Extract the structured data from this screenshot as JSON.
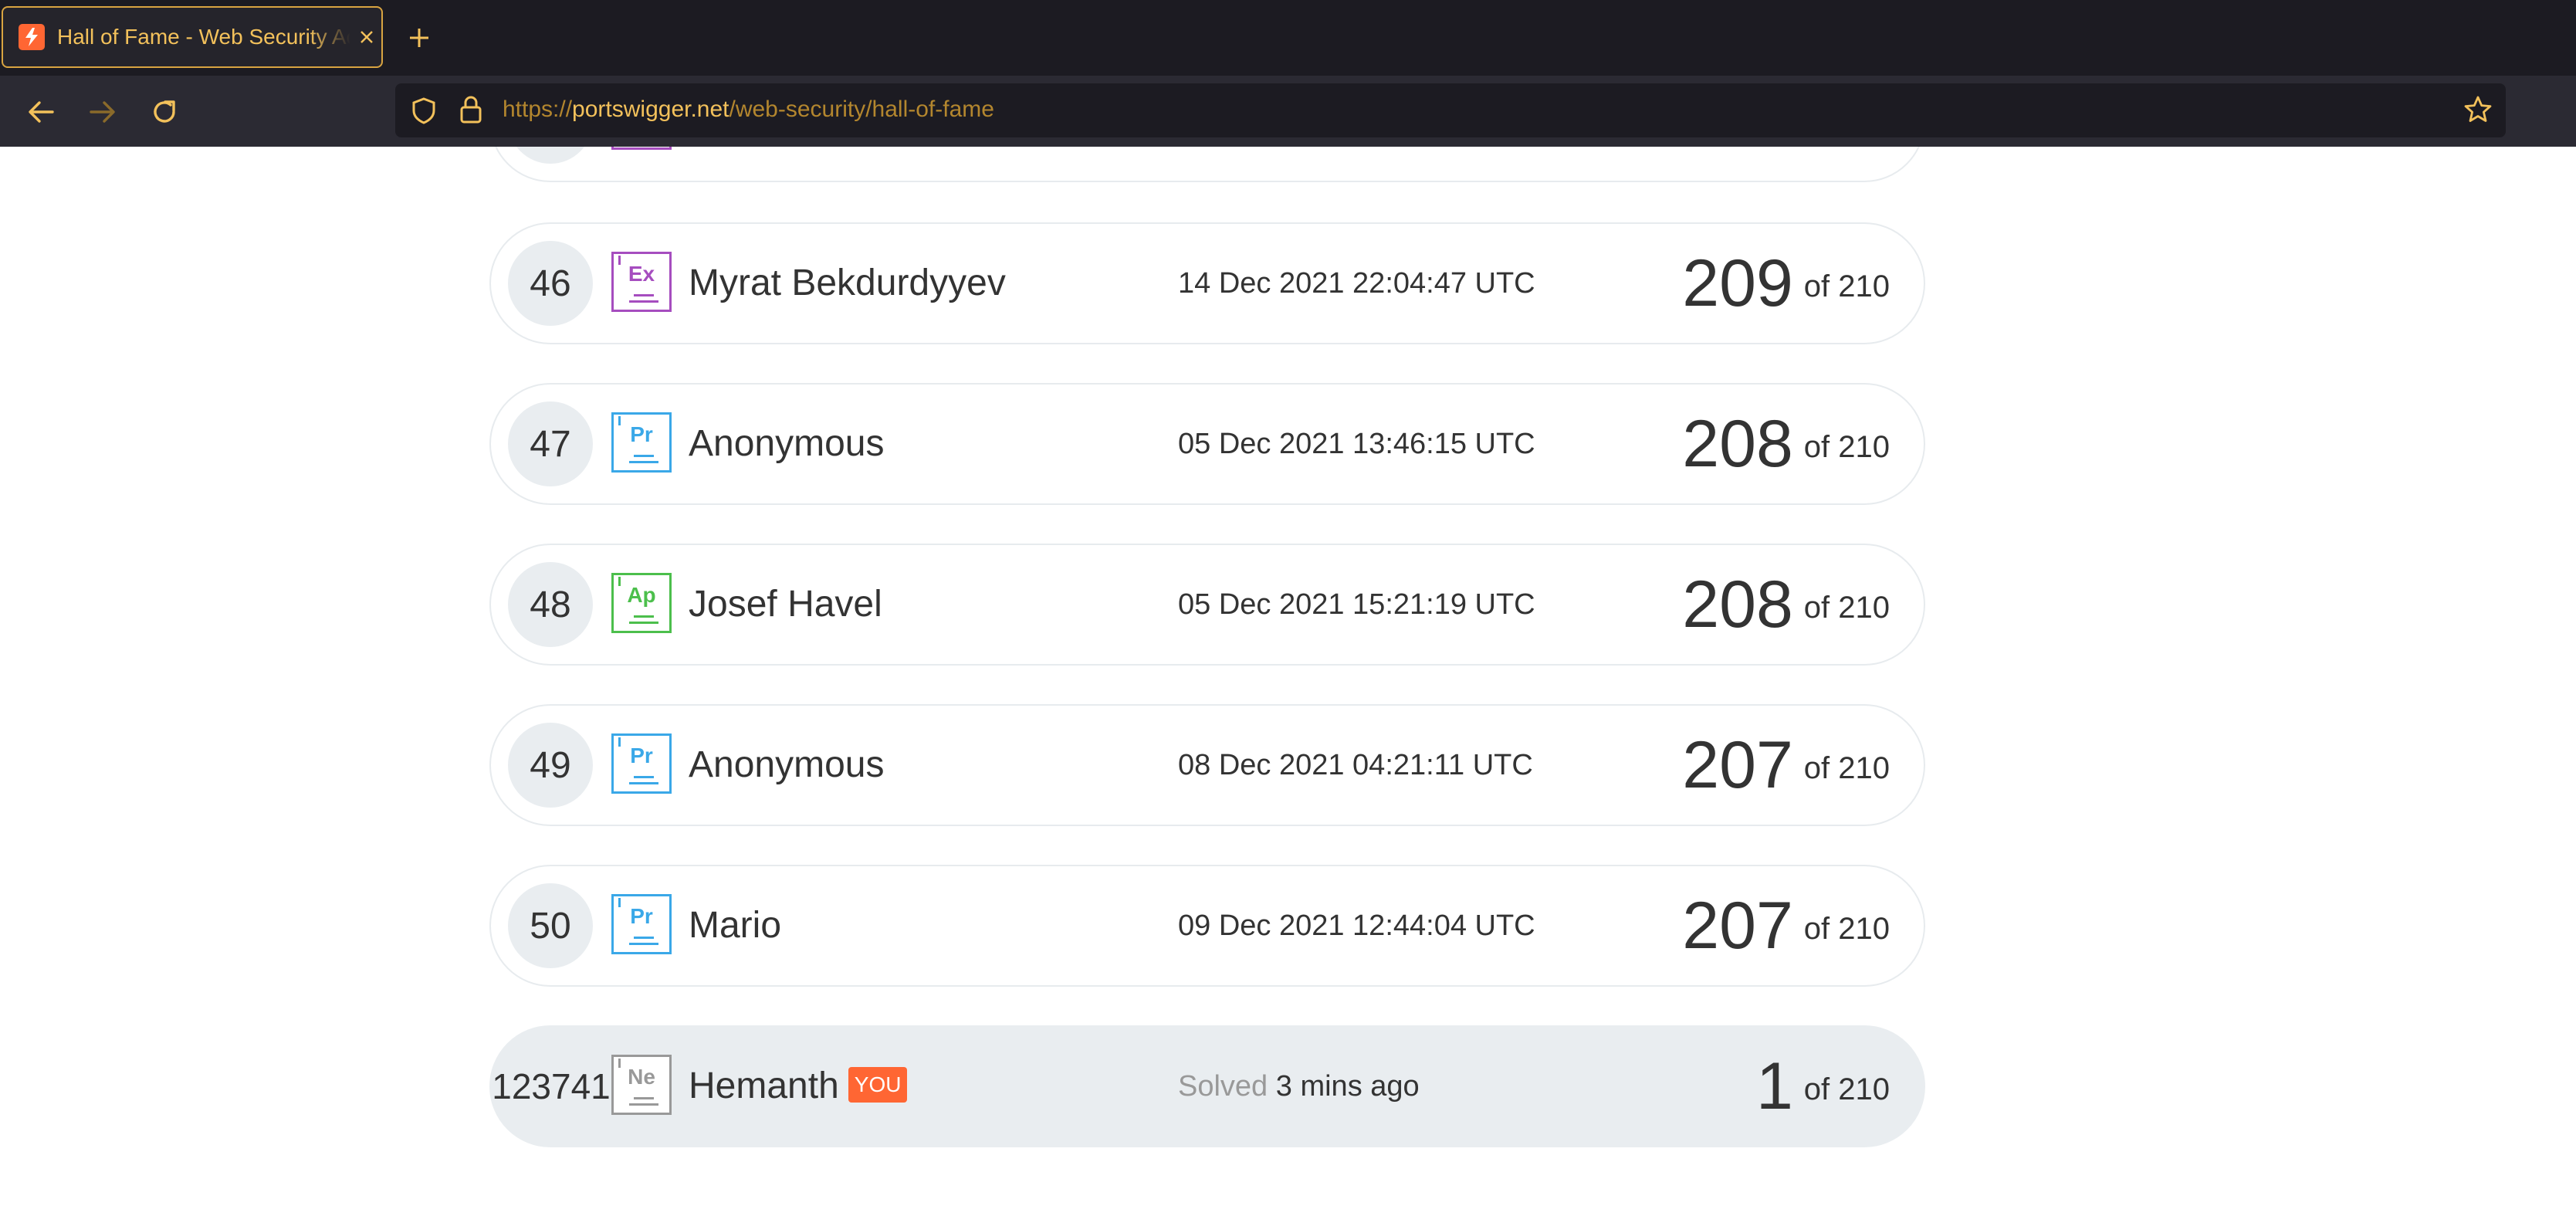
{
  "browser": {
    "tab_title": "Hall of Fame - Web Security Academy",
    "url_scheme": "https://",
    "url_host": "portswigger.net",
    "url_path": "/web-security/hall-of-fame",
    "accent_color": "#f3c15b"
  },
  "leaderboard": {
    "rows": [
      {
        "rank": "46",
        "level": "Ex",
        "level_color": "#a64dbf",
        "name": "Myrat Bekdurdyyev",
        "date": "14 Dec 2021 22:04:47 UTC",
        "solved": "209",
        "of_total": "of 210"
      },
      {
        "rank": "47",
        "level": "Pr",
        "level_color": "#3aa8e8",
        "name": "Anonymous",
        "date": "05 Dec 2021 13:46:15 UTC",
        "solved": "208",
        "of_total": "of 210"
      },
      {
        "rank": "48",
        "level": "Ap",
        "level_color": "#4cbf4c",
        "name": "Josef Havel",
        "date": "05 Dec 2021 15:21:19 UTC",
        "solved": "208",
        "of_total": "of 210"
      },
      {
        "rank": "49",
        "level": "Pr",
        "level_color": "#3aa8e8",
        "name": "Anonymous",
        "date": "08 Dec 2021 04:21:11 UTC",
        "solved": "207",
        "of_total": "of 210"
      },
      {
        "rank": "50",
        "level": "Pr",
        "level_color": "#3aa8e8",
        "name": "Mario",
        "date": "09 Dec 2021 12:44:04 UTC",
        "solved": "207",
        "of_total": "of 210"
      }
    ],
    "you": {
      "rank": "123741",
      "level": "Ne",
      "level_color": "#999999",
      "name": "Hemanth",
      "you_label": "YOU",
      "solved_prefix": "Solved",
      "solved_ago": "3 mins ago",
      "solved": "1",
      "of_total": "of 210"
    }
  }
}
